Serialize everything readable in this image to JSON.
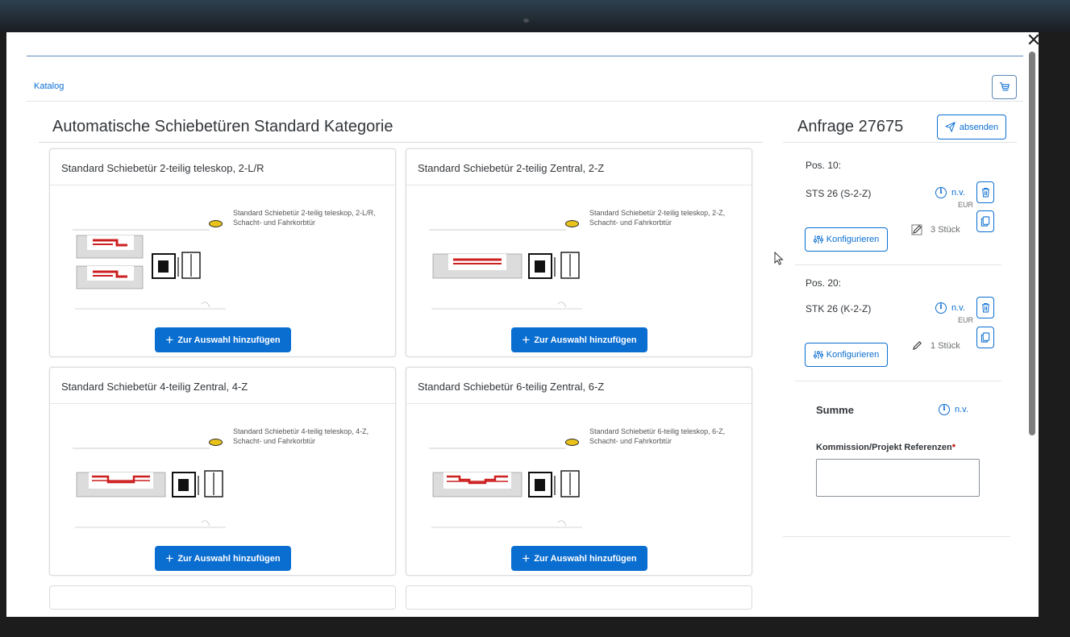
{
  "dialog": {
    "close_glyph": "✕",
    "breadcrumb": "Katalog",
    "cart_icon": "cart-icon"
  },
  "catalog": {
    "title": "Automatische Schiebetüren Standard Kategorie",
    "add_label": "Zur Auswahl hinzufügen",
    "cards": [
      {
        "title": "Standard Schiebetür 2-teilig teleskop, 2-L/R",
        "desc": "Standard Schiebetür 2-teilig teleskop, 2-L/R, Schacht- und Fahrkorbtür"
      },
      {
        "title": "Standard Schiebetür 2-teilig Zentral, 2-Z",
        "desc": "Standard Schiebetür 2-teilig teleskop, 2-Z, Schacht- und Fahrkorbtür"
      },
      {
        "title": "Standard Schiebetür 4-teilig Zentral, 4-Z",
        "desc": "Standard Schiebetür 4-teilig teleskop, 4-Z, Schacht- und Fahrkorbtür"
      },
      {
        "title": "Standard Schiebetür 6-teilig Zentral, 6-Z",
        "desc": "Standard Schiebetür 6-teilig teleskop, 6-Z, Schacht- und Fahrkorbtür"
      }
    ]
  },
  "request": {
    "title": "Anfrage 27675",
    "send_label": "absenden",
    "items": [
      {
        "pos": "Pos. 10:",
        "name": "STS 26 (S-2-Z)",
        "price": "n.v.",
        "currency": "EUR",
        "config_label": "Konfigurieren",
        "qty": "3",
        "unit": "Stück"
      },
      {
        "pos": "Pos. 20:",
        "name": "STK 26 (K-2-Z)",
        "price": "n.v.",
        "currency": "EUR",
        "config_label": "Konfigurieren",
        "qty": "1",
        "unit": "Stück"
      }
    ],
    "sum_label": "Summe",
    "sum_value": "n.v.",
    "ref_label": "Kommission/Projekt Referenzen",
    "ref_required": "*",
    "ref_value": ""
  },
  "colors": {
    "accent": "#0a6ed1",
    "door_red": "#cc1f1f",
    "required": "#bb0000"
  }
}
